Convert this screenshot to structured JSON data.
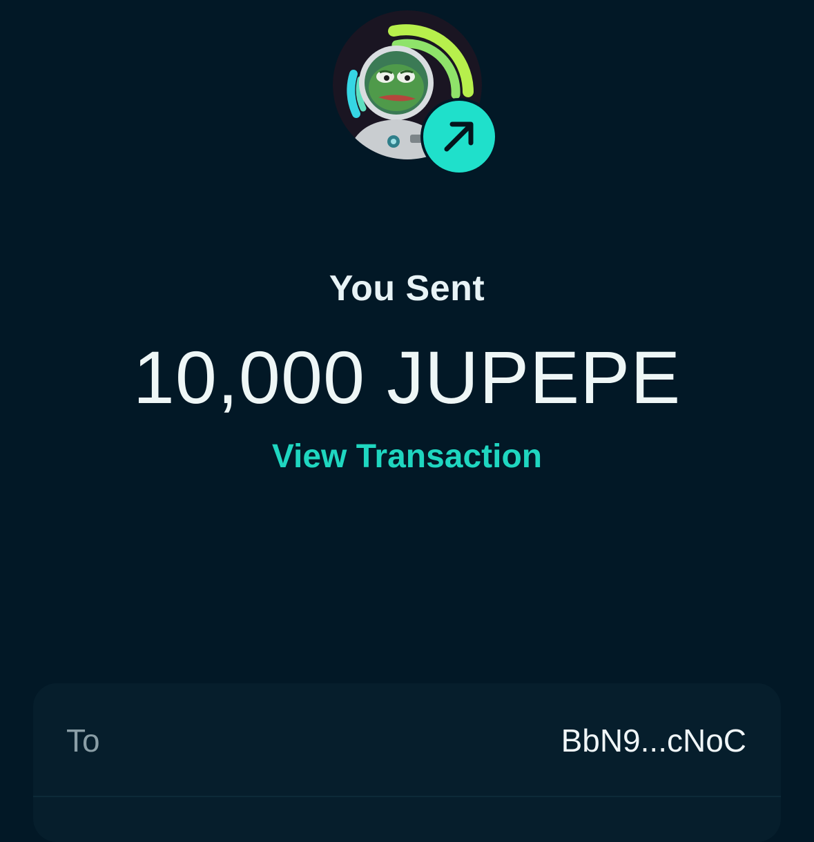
{
  "token": {
    "symbol": "JUPEPE",
    "avatar_icon": "astronaut-pepe-token-icon",
    "badge_icon": "arrow-up-right-icon",
    "badge_color": "#1fe0cb"
  },
  "header": {
    "title": "You Sent",
    "amount": "10,000 JUPEPE",
    "link_label": "View Transaction"
  },
  "details": {
    "rows": [
      {
        "label": "To",
        "value": "BbN9...cNoC"
      }
    ]
  },
  "colors": {
    "background": "#021826",
    "accent": "#1fd6c0",
    "card": "#061e2c",
    "muted_text": "#8a9ea6"
  }
}
